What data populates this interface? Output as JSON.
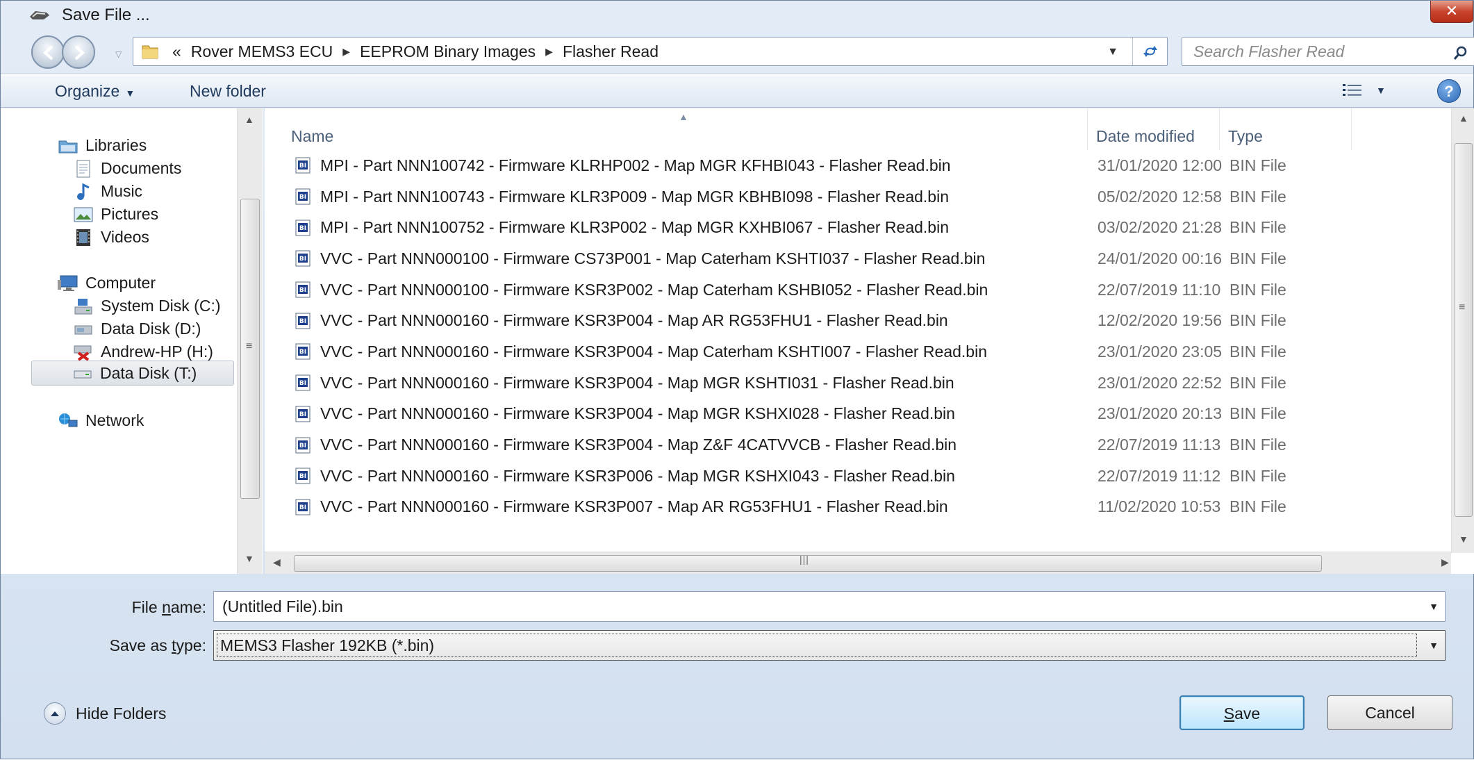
{
  "window": {
    "title": "Save File ...",
    "close_label": "✕"
  },
  "address": {
    "overflow": "«",
    "crumbs": [
      "Rover MEMS3 ECU",
      "EEPROM Binary Images",
      "Flasher Read"
    ],
    "search_placeholder": "Search Flasher Read"
  },
  "toolbar": {
    "organize": "Organize",
    "new_folder": "New folder",
    "help": "?"
  },
  "nav": {
    "libraries": "Libraries",
    "documents": "Documents",
    "music": "Music",
    "pictures": "Pictures",
    "videos": "Videos",
    "computer": "Computer",
    "system_disk": "System Disk (C:)",
    "data_disk_d": "Data Disk (D:)",
    "andrew_hp": "Andrew-HP (H:)",
    "data_disk_t": "Data Disk (T:)",
    "network": "Network"
  },
  "columns": {
    "name": "Name",
    "date": "Date modified",
    "type": "Type"
  },
  "files": [
    {
      "name": "MPI - Part NNN100742 - Firmware KLRHP002 - Map MGR KFHBI043 - Flasher Read.bin",
      "date": "31/01/2020 12:00",
      "type": "BIN File"
    },
    {
      "name": "MPI - Part NNN100743 - Firmware KLR3P009 - Map MGR KBHBI098 - Flasher Read.bin",
      "date": "05/02/2020 12:58",
      "type": "BIN File"
    },
    {
      "name": "MPI - Part NNN100752 - Firmware KLR3P002 - Map MGR KXHBI067 - Flasher Read.bin",
      "date": "03/02/2020 21:28",
      "type": "BIN File"
    },
    {
      "name": "VVC - Part NNN000100 - Firmware CS73P001 - Map Caterham KSHTI037 - Flasher Read.bin",
      "date": "24/01/2020 00:16",
      "type": "BIN File"
    },
    {
      "name": "VVC - Part NNN000100 - Firmware KSR3P002 - Map Caterham KSHBI052 - Flasher Read.bin",
      "date": "22/07/2019 11:10",
      "type": "BIN File"
    },
    {
      "name": "VVC - Part NNN000160 - Firmware KSR3P004 - Map AR RG53FHU1 - Flasher Read.bin",
      "date": "12/02/2020 19:56",
      "type": "BIN File"
    },
    {
      "name": "VVC - Part NNN000160 - Firmware KSR3P004 - Map Caterham KSHTI007 - Flasher Read.bin",
      "date": "23/01/2020 23:05",
      "type": "BIN File"
    },
    {
      "name": "VVC - Part NNN000160 - Firmware KSR3P004 - Map MGR KSHTI031 - Flasher Read.bin",
      "date": "23/01/2020 22:52",
      "type": "BIN File"
    },
    {
      "name": "VVC - Part NNN000160 - Firmware KSR3P004 - Map MGR KSHXI028 - Flasher Read.bin",
      "date": "23/01/2020 20:13",
      "type": "BIN File"
    },
    {
      "name": "VVC - Part NNN000160 - Firmware KSR3P004 - Map Z&F 4CATVVCB - Flasher Read.bin",
      "date": "22/07/2019 11:13",
      "type": "BIN File"
    },
    {
      "name": "VVC - Part NNN000160 - Firmware KSR3P006 - Map MGR KSHXI043 - Flasher Read.bin",
      "date": "22/07/2019 11:12",
      "type": "BIN File"
    },
    {
      "name": "VVC - Part NNN000160 - Firmware KSR3P007 - Map AR RG53FHU1 - Flasher Read.bin",
      "date": "11/02/2020 10:53",
      "type": "BIN File"
    }
  ],
  "form": {
    "file_name_label_pre": "File ",
    "file_name_label_key": "n",
    "file_name_label_post": "ame:",
    "file_name_value": "(Untitled File).bin",
    "save_type_label_pre": "Save as ",
    "save_type_label_key": "t",
    "save_type_label_post": "ype:",
    "save_type_value": "MEMS3 Flasher 192KB (*.bin)",
    "hide_folders": "Hide Folders",
    "save_key": "S",
    "save_rest": "ave",
    "cancel": "Cancel"
  },
  "colors": {
    "accent": "#3c7fb1",
    "close": "#c8452e",
    "chrome": "#d3e0ef"
  }
}
